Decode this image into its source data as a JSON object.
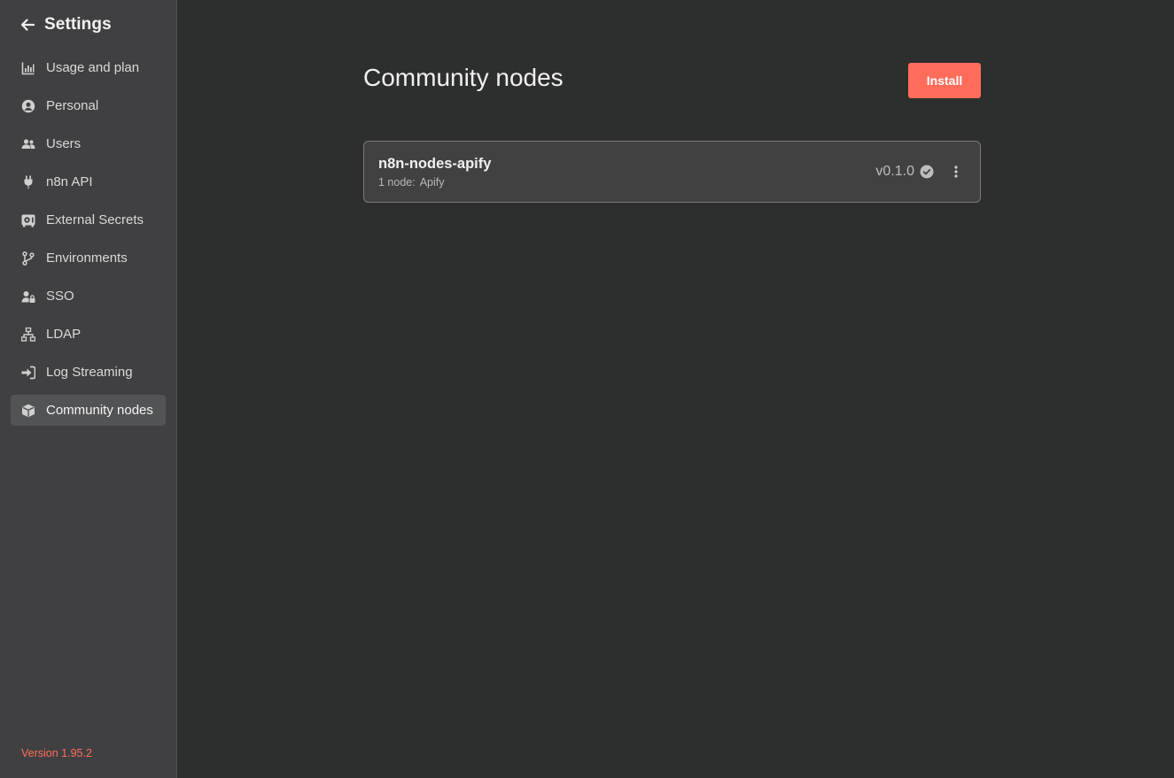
{
  "sidebar": {
    "title": "Settings",
    "items": [
      {
        "label": "Usage and plan",
        "icon": "chart-icon"
      },
      {
        "label": "Personal",
        "icon": "user-circle-icon"
      },
      {
        "label": "Users",
        "icon": "users-icon"
      },
      {
        "label": "n8n API",
        "icon": "plug-icon"
      },
      {
        "label": "External Secrets",
        "icon": "vault-icon"
      },
      {
        "label": "Environments",
        "icon": "branch-icon"
      },
      {
        "label": "SSO",
        "icon": "user-lock-icon"
      },
      {
        "label": "LDAP",
        "icon": "network-icon"
      },
      {
        "label": "Log Streaming",
        "icon": "sign-in-icon"
      },
      {
        "label": "Community nodes",
        "icon": "cube-icon",
        "active": true
      }
    ],
    "version": "Version 1.95.2"
  },
  "main": {
    "title": "Community nodes",
    "install_label": "Install",
    "packages": [
      {
        "name": "n8n-nodes-apify",
        "nodes_prefix": "1 node:",
        "nodes_list": "Apify",
        "version": "v0.1.0"
      }
    ]
  },
  "colors": {
    "accent": "#ff6d5a",
    "sidebar_bg": "#404042",
    "main_bg": "#2d2e2e",
    "card_bg": "#414142"
  }
}
